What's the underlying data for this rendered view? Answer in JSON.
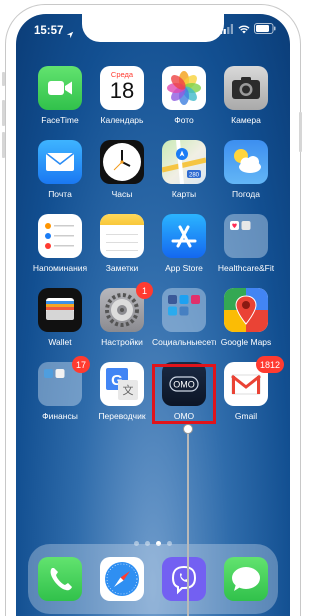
{
  "status_bar": {
    "time": "15:57"
  },
  "apps": [
    {
      "id": "facetime",
      "label": "FaceTime"
    },
    {
      "id": "calendar",
      "label": "Календарь",
      "weekday": "Среда",
      "day": "18"
    },
    {
      "id": "photos",
      "label": "Фото"
    },
    {
      "id": "camera",
      "label": "Камера"
    },
    {
      "id": "mail",
      "label": "Почта"
    },
    {
      "id": "clock",
      "label": "Часы"
    },
    {
      "id": "maps",
      "label": "Карты",
      "route_number": "280"
    },
    {
      "id": "weather",
      "label": "Погода"
    },
    {
      "id": "reminders",
      "label": "Напоминания"
    },
    {
      "id": "notes",
      "label": "Заметки"
    },
    {
      "id": "appstore",
      "label": "App Store"
    },
    {
      "id": "health-folder",
      "label": "Healthcare&Fit"
    },
    {
      "id": "wallet",
      "label": "Wallet"
    },
    {
      "id": "settings",
      "label": "Настройки",
      "badge": "1"
    },
    {
      "id": "social-folder",
      "label": "Социальныесети"
    },
    {
      "id": "googlemaps",
      "label": "Google Maps"
    },
    {
      "id": "finance-folder",
      "label": "Финансы",
      "badge": "17"
    },
    {
      "id": "translate",
      "label": "Переводчик"
    },
    {
      "id": "omo",
      "label": "OMO",
      "logo_text": "OMO"
    },
    {
      "id": "gmail",
      "label": "Gmail",
      "badge": "1812"
    }
  ],
  "page_dots": {
    "count": 4,
    "active_index": 2
  },
  "dock": [
    "phone",
    "safari",
    "viber",
    "messages"
  ],
  "colors": {
    "highlight": "#e0141b",
    "badge": "#ff3b30"
  }
}
